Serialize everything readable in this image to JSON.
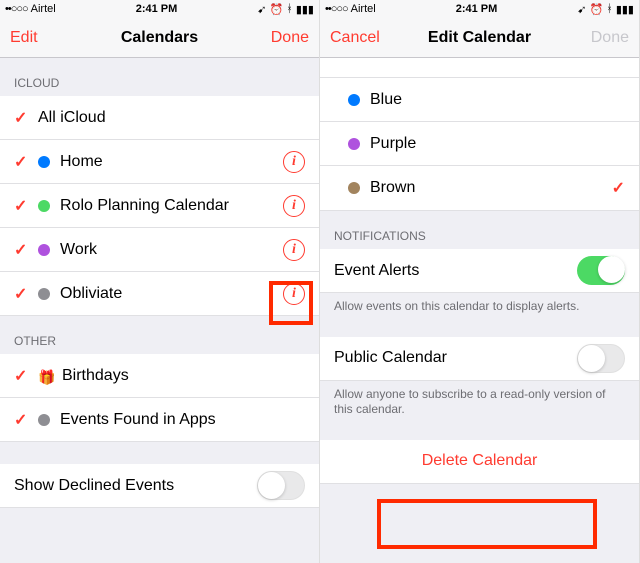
{
  "status": {
    "carrier": "Airtel",
    "time": "2:41 PM",
    "signal": "••○○○"
  },
  "left": {
    "nav": {
      "left": "Edit",
      "title": "Calendars",
      "right": "Done"
    },
    "sections": {
      "icloud": {
        "header": "ICLOUD",
        "items": [
          {
            "label": "All iCloud"
          },
          {
            "label": "Home",
            "color": "#007aff"
          },
          {
            "label": "Rolo Planning Calendar",
            "color": "#4cd964"
          },
          {
            "label": "Work",
            "color": "#af52de"
          },
          {
            "label": "Obliviate",
            "color": "#8e8e93"
          }
        ]
      },
      "other": {
        "header": "OTHER",
        "items": [
          {
            "label": "Birthdays"
          },
          {
            "label": "Events Found in Apps",
            "color": "#8e8e93"
          }
        ]
      }
    },
    "show_declined": "Show Declined Events"
  },
  "right": {
    "nav": {
      "left": "Cancel",
      "title": "Edit Calendar",
      "right": "Done"
    },
    "colors": [
      {
        "label": "Blue",
        "color": "#007aff"
      },
      {
        "label": "Purple",
        "color": "#af52de"
      },
      {
        "label": "Brown",
        "color": "#a2845e",
        "checked": true
      }
    ],
    "notifications": {
      "header": "NOTIFICATIONS",
      "event_alerts": "Event Alerts",
      "footer": "Allow events on this calendar to display alerts."
    },
    "public": {
      "label": "Public Calendar",
      "footer": "Allow anyone to subscribe to a read-only version of this calendar."
    },
    "delete": "Delete Calendar"
  }
}
